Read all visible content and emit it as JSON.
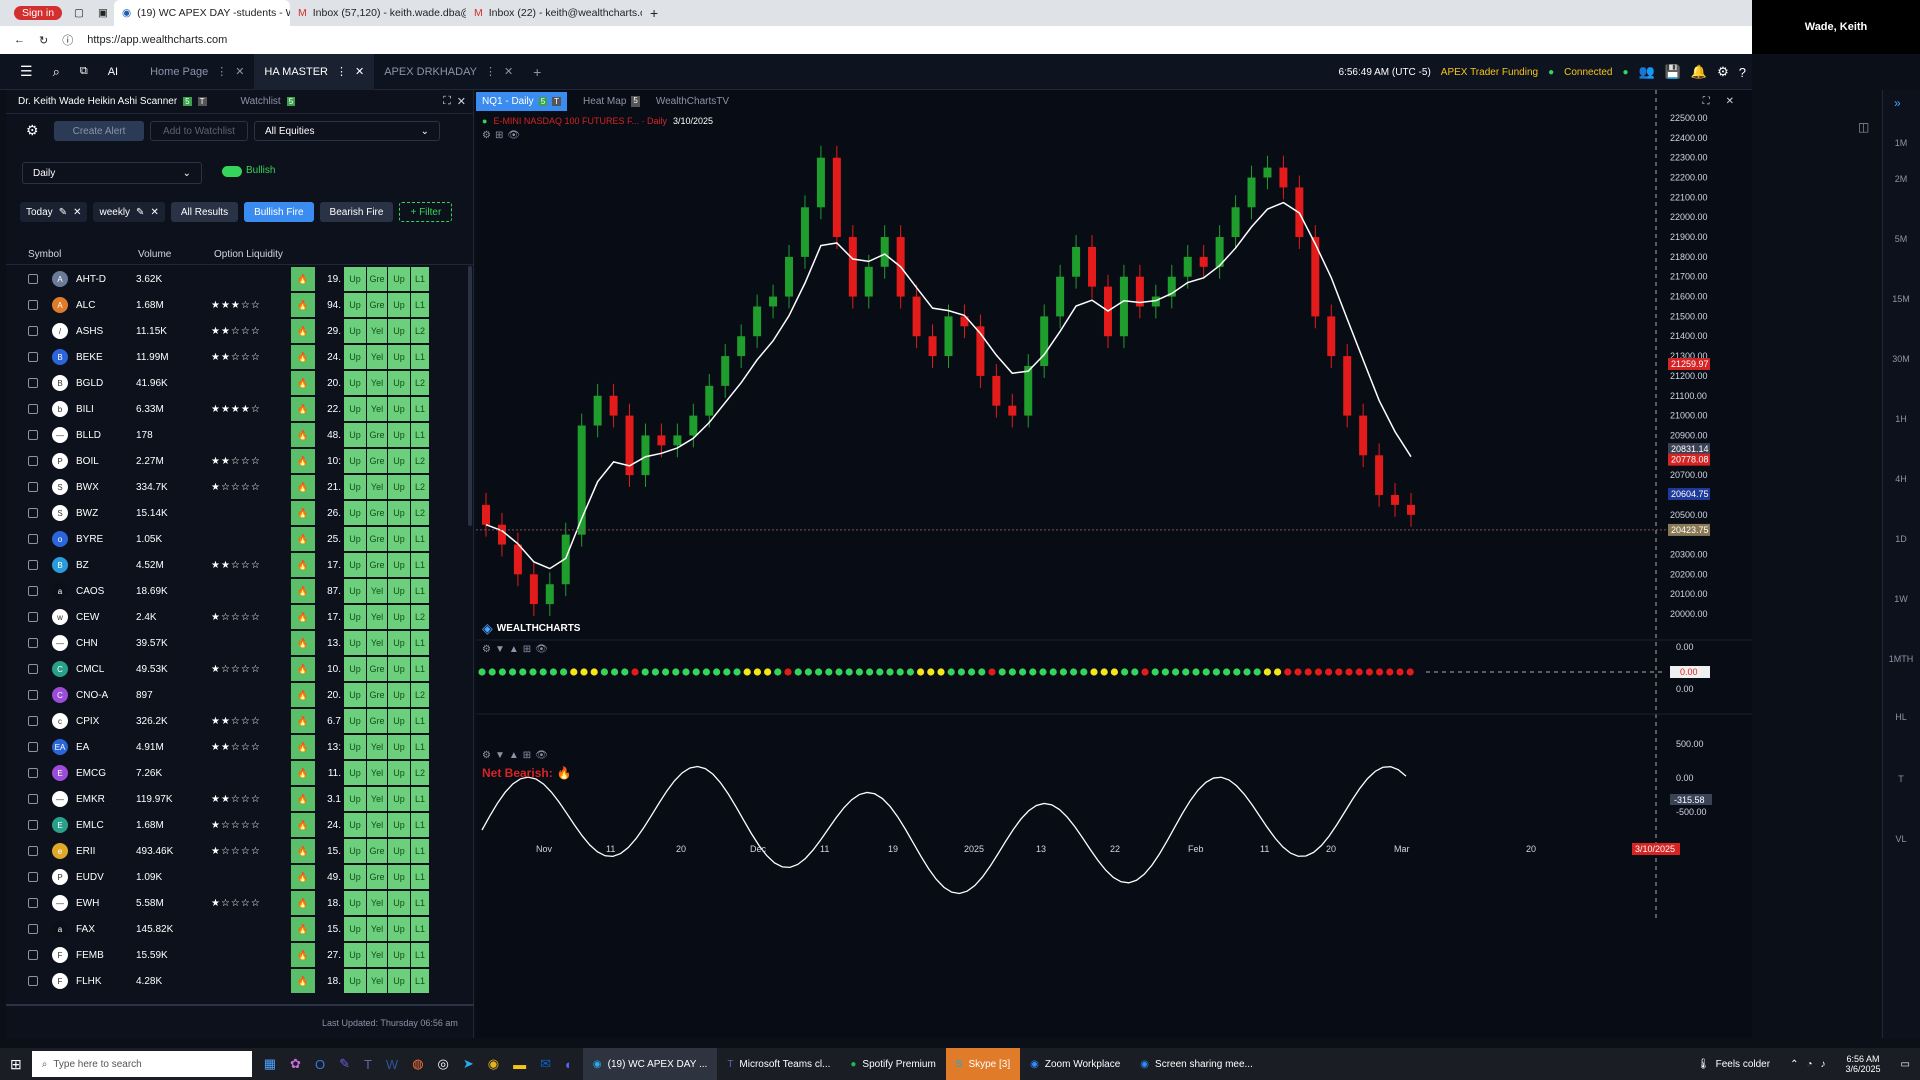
{
  "browser": {
    "tabs": [
      {
        "label": "Sign in"
      },
      {
        "label": "(19) WC APEX DAY -students - W"
      },
      {
        "label": "Inbox (57,120) - keith.wade.dba@"
      },
      {
        "label": "Inbox (22) - keith@wealthcharts.c"
      }
    ],
    "url": "https://app.wealthcharts.com"
  },
  "webcam": {
    "name": "Wade, Keith"
  },
  "app": {
    "tabs": [
      {
        "label": "Home Page"
      },
      {
        "label": "HA MASTER"
      },
      {
        "label": "APEX DRKHADAY"
      }
    ],
    "clock": "6:56:49 AM (UTC -5)",
    "account": "APEX Trader Funding",
    "status": "Connected",
    "ai_label": "AI"
  },
  "scanner": {
    "title": "Dr. Keith Wade Heikin Ashi Scanner",
    "title_badge1": "5",
    "title_badge2": "T",
    "watchlist_tab": "Watchlist",
    "watchlist_badge": "5",
    "create_alert": "Create Alert",
    "add_to_watchlist": "Add to Watchlist",
    "universe": "All Equities",
    "timeframe": "Daily",
    "toggle_label": "Bullish",
    "chips": [
      {
        "label": "Today"
      },
      {
        "label": "weekly"
      }
    ],
    "filters": [
      "All Results",
      "Bullish Fire",
      "Bearish Fire"
    ],
    "add_filter": "+ Filter",
    "columns": {
      "symbol": "Symbol",
      "volume": "Volume",
      "option_liquidity": "Option Liquidity"
    },
    "rows": [
      {
        "symbol": "AHT-D",
        "volume": "3.62K",
        "stars": 0,
        "num": "19.",
        "c2": "Gre",
        "c4": "L1",
        "logo": "A",
        "color": "#6b7a99"
      },
      {
        "symbol": "ALC",
        "volume": "1.68M",
        "stars": 3,
        "num": "94.",
        "c2": "Gre",
        "c4": "L1",
        "logo": "A",
        "color": "#e07b2a"
      },
      {
        "symbol": "ASHS",
        "volume": "11.15K",
        "stars": 2,
        "num": "29.",
        "c2": "Yel",
        "c4": "L2",
        "logo": "/",
        "color": "#ffffff"
      },
      {
        "symbol": "BEKE",
        "volume": "11.99M",
        "stars": 2,
        "num": "24.",
        "c2": "Yel",
        "c4": "L1",
        "logo": "B",
        "color": "#2a66d9"
      },
      {
        "symbol": "BGLD",
        "volume": "41.96K",
        "stars": 0,
        "num": "20.",
        "c2": "Yel",
        "c4": "L2",
        "logo": "B",
        "color": "#ffffff"
      },
      {
        "symbol": "BILI",
        "volume": "6.33M",
        "stars": 4,
        "num": "22.",
        "c2": "Yel",
        "c4": "L1",
        "logo": "b",
        "color": "#ffffff"
      },
      {
        "symbol": "BLLD",
        "volume": "178",
        "stars": 0,
        "num": "48.",
        "c2": "Gre",
        "c4": "L1",
        "logo": "—",
        "color": "#ffffff"
      },
      {
        "symbol": "BOIL",
        "volume": "2.27M",
        "stars": 2,
        "num": "10:",
        "c2": "Gre",
        "c4": "L2",
        "logo": "P",
        "color": "#ffffff"
      },
      {
        "symbol": "BWX",
        "volume": "334.7K",
        "stars": 1,
        "num": "21.",
        "c2": "Yel",
        "c4": "L2",
        "logo": "S",
        "color": "#ffffff"
      },
      {
        "symbol": "BWZ",
        "volume": "15.14K",
        "stars": 0,
        "num": "26.",
        "c2": "Gre",
        "c4": "L2",
        "logo": "S",
        "color": "#ffffff"
      },
      {
        "symbol": "BYRE",
        "volume": "1.05K",
        "stars": 0,
        "num": "25.",
        "c2": "Gre",
        "c4": "L1",
        "logo": "o",
        "color": "#2a66d9"
      },
      {
        "symbol": "BZ",
        "volume": "4.52M",
        "stars": 2,
        "num": "17.",
        "c2": "Gre",
        "c4": "L1",
        "logo": "B",
        "color": "#2a9cd9"
      },
      {
        "symbol": "CAOS",
        "volume": "18.69K",
        "stars": 0,
        "num": "87.",
        "c2": "Yel",
        "c4": "L1",
        "logo": "a",
        "color": "#0b0f17"
      },
      {
        "symbol": "CEW",
        "volume": "2.4K",
        "stars": 1,
        "num": "17.",
        "c2": "Yel",
        "c4": "L2",
        "logo": "w",
        "color": "#ffffff"
      },
      {
        "symbol": "CHN",
        "volume": "39.57K",
        "stars": 0,
        "num": "13.",
        "c2": "Yel",
        "c4": "L1",
        "logo": "—",
        "color": "#ffffff"
      },
      {
        "symbol": "CMCL",
        "volume": "49.53K",
        "stars": 1,
        "num": "10.",
        "c2": "Gre",
        "c4": "L1",
        "logo": "C",
        "color": "#28a08a"
      },
      {
        "symbol": "CNO-A",
        "volume": "897",
        "stars": 0,
        "num": "20.",
        "c2": "Gre",
        "c4": "L2",
        "logo": "C",
        "color": "#9b4dd9"
      },
      {
        "symbol": "CPIX",
        "volume": "326.2K",
        "stars": 2,
        "num": "6.7",
        "c2": "Gre",
        "c4": "L1",
        "logo": "c",
        "color": "#ffffff"
      },
      {
        "symbol": "EA",
        "volume": "4.91M",
        "stars": 2,
        "num": "13:",
        "c2": "Yel",
        "c4": "L1",
        "logo": "EA",
        "color": "#2a66d9"
      },
      {
        "symbol": "EMCG",
        "volume": "7.26K",
        "stars": 0,
        "num": "11.",
        "c2": "Yel",
        "c4": "L2",
        "logo": "E",
        "color": "#9b4dd9"
      },
      {
        "symbol": "EMKR",
        "volume": "119.97K",
        "stars": 2,
        "num": "3.1",
        "c2": "Yel",
        "c4": "L1",
        "logo": "—",
        "color": "#ffffff"
      },
      {
        "symbol": "EMLC",
        "volume": "1.68M",
        "stars": 1,
        "num": "24.",
        "c2": "Yel",
        "c4": "L1",
        "logo": "E",
        "color": "#28a08a"
      },
      {
        "symbol": "ERII",
        "volume": "493.46K",
        "stars": 1,
        "num": "15.",
        "c2": "Gre",
        "c4": "L1",
        "logo": "e",
        "color": "#e0a82a"
      },
      {
        "symbol": "EUDV",
        "volume": "1.09K",
        "stars": 0,
        "num": "49.",
        "c2": "Gre",
        "c4": "L1",
        "logo": "P",
        "color": "#ffffff"
      },
      {
        "symbol": "EWH",
        "volume": "5.58M",
        "stars": 1,
        "num": "18.",
        "c2": "Yel",
        "c4": "L1",
        "logo": "—",
        "color": "#ffffff"
      },
      {
        "symbol": "FAX",
        "volume": "145.82K",
        "stars": 0,
        "num": "15.",
        "c2": "Yel",
        "c4": "L1",
        "logo": "a",
        "color": "#0b0f17"
      },
      {
        "symbol": "FEMB",
        "volume": "15.59K",
        "stars": 0,
        "num": "27.",
        "c2": "Yel",
        "c4": "L1",
        "logo": "F",
        "color": "#ffffff"
      },
      {
        "symbol": "FLHK",
        "volume": "4.28K",
        "stars": 0,
        "num": "18.",
        "c2": "Yel",
        "c4": "L1",
        "logo": "F",
        "color": "#ffffff"
      }
    ],
    "up_label": "Up",
    "last_updated": "Last Updated: Thursday 06:56 am"
  },
  "chart": {
    "tabs": [
      {
        "label": "NQ1 - Daily",
        "b1": "5",
        "b2": "T"
      },
      {
        "label": "Heat Map",
        "b1": "5"
      },
      {
        "label": "WealthChartsTV"
      }
    ],
    "symbol_line": "E-MINI NASDAQ 100 FUTURES F... · Daily",
    "date": "3/10/2025",
    "watermark": "WEALTHCHARTS",
    "net_label": "Net Bearish:",
    "price_ticks": [
      "22500.00",
      "22400.00",
      "22300.00",
      "22200.00",
      "22100.00",
      "22000.00",
      "21900.00",
      "21800.00",
      "21700.00",
      "21600.00",
      "21500.00",
      "21400.00",
      "21300.00",
      "21200.00",
      "21100.00",
      "21000.00",
      "20900.00",
      "20700.00",
      "20600.00",
      "20500.00",
      "20300.00",
      "20200.00",
      "20100.00",
      "20000.00"
    ],
    "price_tags": [
      {
        "label": "21259.97",
        "color": "#d62424"
      },
      {
        "label": "20831.14",
        "color": "#3a4256"
      },
      {
        "label": "20778.08",
        "color": "#d62424"
      },
      {
        "label": "20604.75",
        "color": "#1e3a9a"
      },
      {
        "label": "20423.75",
        "color": "#8a7a55"
      }
    ],
    "ind1_ticks": [
      "0.00",
      "0.00"
    ],
    "ind1_tag": "0.00",
    "ind2_ticks": [
      "500.00",
      "0.00",
      "-500.00"
    ],
    "ind2_tag": "-315.58",
    "date_ticks": [
      "Nov",
      "11",
      "20",
      "Dec",
      "11",
      "19",
      "2025",
      "13",
      "22",
      "Feb",
      "11",
      "20",
      "Mar",
      "20"
    ],
    "cursor_date": "3/10/2025",
    "tf_labels": [
      "1M",
      "2M",
      "5M",
      "15M",
      "30M",
      "1H",
      "4H",
      "1D",
      "1W",
      "1MTH",
      "HL",
      "T",
      "VL"
    ]
  },
  "taskbar": {
    "search": "Type here to search",
    "items": [
      "(19) WC APEX DAY ...",
      "Microsoft Teams cl...",
      "Spotify Premium",
      "Skype [3]",
      "Zoom Workplace",
      "Screen sharing mee..."
    ],
    "weather": "Feels colder",
    "time": "6:56 AM",
    "date": "3/6/2025"
  }
}
